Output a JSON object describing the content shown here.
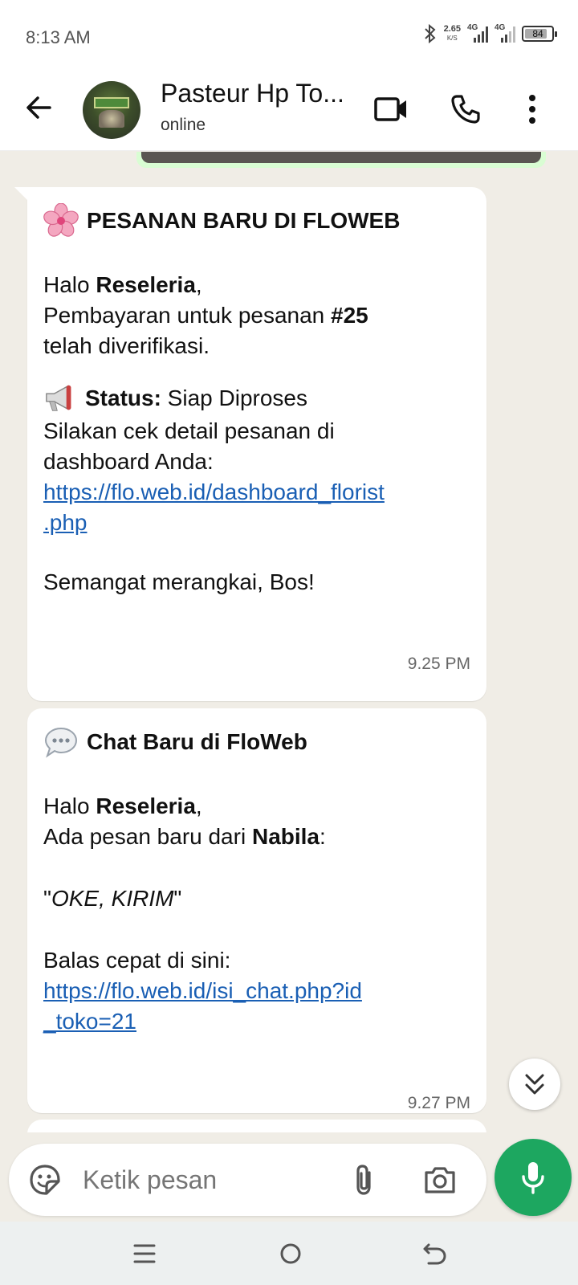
{
  "status_bar": {
    "time": "8:13 AM",
    "net_speed": "2.65",
    "net_unit": "K/S",
    "sim1": "4G",
    "sim2": "4G",
    "battery": "84"
  },
  "header": {
    "contact_name": "Pasteur Hp To...",
    "contact_status": "online"
  },
  "messages": [
    {
      "title": "PESANAN BARU DI FLOWEB",
      "greeting_prefix": "Halo ",
      "greeting_name": "Reseleria",
      "greeting_suffix": ",",
      "line2_prefix": "Pembayaran untuk pesanan ",
      "line2_order": "#25",
      "line3": "telah diverifikasi.",
      "status_label": "Status:",
      "status_value": " Siap Diproses",
      "line5": "Silakan cek detail pesanan di",
      "line6": "dashboard Anda:",
      "link": "https://flo.web.id/dashboard_florist.php",
      "link_part1": "https://flo.web.id/dashboard_florist",
      "link_part2": ".php",
      "closing": "Semangat merangkai, Bos!",
      "time": "9.25 PM"
    },
    {
      "title": "Chat Baru di FloWeb",
      "greeting_prefix": "Halo ",
      "greeting_name": "Reseleria",
      "greeting_suffix": ",",
      "line2_prefix": "Ada pesan baru dari ",
      "line2_name": "Nabila",
      "line2_suffix": ":",
      "quote_open": "\"",
      "quote_text": "OKE, KIRIM",
      "quote_close": "\"",
      "reply_label": "Balas cepat di sini:",
      "link": "https://flo.web.id/isi_chat.php?id_toko=21",
      "link_part1": "https://flo.web.id/isi_chat.php?id",
      "link_part2": "_toko=21",
      "time": "9.27 PM"
    }
  ],
  "composer": {
    "placeholder": "Ketik pesan"
  },
  "colors": {
    "accent_green": "#1DA760",
    "chat_background": "#F0EDE6",
    "link": "#1A5FB4"
  },
  "icons": [
    "back-arrow-icon",
    "video-call-icon",
    "voice-call-icon",
    "more-options-icon",
    "cherry-blossom-emoji",
    "megaphone-emoji",
    "speech-balloon-emoji",
    "sticker-icon",
    "attach-icon",
    "camera-icon",
    "mic-icon",
    "scroll-down-icon",
    "menu-nav-icon",
    "home-nav-icon",
    "back-nav-icon"
  ]
}
